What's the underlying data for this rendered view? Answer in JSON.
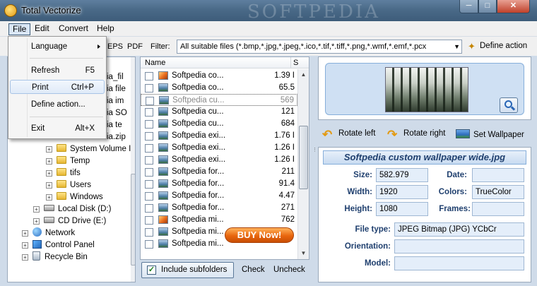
{
  "window": {
    "title": "Total Vectorize",
    "watermark": "SOFTPEDIA",
    "minimize": "─",
    "maximize": "□",
    "close": "✕"
  },
  "menubar": {
    "items": [
      "File",
      "Edit",
      "Convert",
      "Help"
    ]
  },
  "file_menu": {
    "items": [
      {
        "label": "Language",
        "shortcut": ""
      },
      {
        "label": "Refresh",
        "shortcut": "F5"
      },
      {
        "label": "Print",
        "shortcut": "Ctrl+P"
      },
      {
        "label": "Define action...",
        "shortcut": ""
      },
      {
        "label": "Exit",
        "shortcut": "Alt+X"
      }
    ]
  },
  "toolbar": {
    "formats": [
      "EPS",
      "PDF"
    ],
    "filter_label": "Filter:",
    "filter_value": "All suitable files (*.bmp,*.jpg,*.jpeg,*.ico,*.tif,*.tiff,*.png,*.wmf,*.emf,*.pcx",
    "define_action": "Define action"
  },
  "tree": {
    "partial_rows": [
      "ia_fil",
      "ia file",
      "ia im",
      "ia SO",
      "ia te",
      "ia.zip"
    ],
    "folders": [
      "System Volume I",
      "Temp",
      "tifs",
      "Users",
      "Windows"
    ],
    "drives": [
      "Local Disk (D:)",
      "CD Drive (E:)"
    ],
    "roots": [
      "Network",
      "Control Panel",
      "Recycle Bin"
    ]
  },
  "filelist": {
    "col_name": "Name",
    "col_size": "S",
    "rows": [
      {
        "name": "Softpedia co...",
        "size": "1.39 I",
        "icon": "orange"
      },
      {
        "name": "Softpedia co...",
        "size": "65.5",
        "icon": "blue"
      },
      {
        "name": "Softpedia cu...",
        "size": "569",
        "icon": "blue"
      },
      {
        "name": "Softpedia cu...",
        "size": "121",
        "icon": "blue"
      },
      {
        "name": "Softpedia cu...",
        "size": "684",
        "icon": "blue"
      },
      {
        "name": "Softpedia exi...",
        "size": "1.76 I",
        "icon": "blue"
      },
      {
        "name": "Softpedia exi...",
        "size": "1.26 I",
        "icon": "blue"
      },
      {
        "name": "Softpedia exi...",
        "size": "1.26 I",
        "icon": "blue"
      },
      {
        "name": "Softpedia for...",
        "size": "211",
        "icon": "blue"
      },
      {
        "name": "Softpedia for...",
        "size": "91.4",
        "icon": "blue"
      },
      {
        "name": "Softpedia for...",
        "size": "4.47",
        "icon": "blue"
      },
      {
        "name": "Softpedia for...",
        "size": "271",
        "icon": "blue"
      },
      {
        "name": "Softpedia mi...",
        "size": "762",
        "icon": "orange"
      },
      {
        "name": "Softpedia mi...",
        "size": "",
        "icon": "blue"
      },
      {
        "name": "Softpedia mi...",
        "size": "",
        "icon": "blue"
      }
    ]
  },
  "buy_now": "BUY Now!",
  "bottom": {
    "include_subfolders": "Include subfolders",
    "check": "Check",
    "uncheck": "Uncheck"
  },
  "actions": {
    "rotate_left": "Rotate left",
    "rotate_right": "Rotate right",
    "set_wallpaper": "Set Wallpaper"
  },
  "info": {
    "filename": "Softpedia custom wallpaper wide.jpg",
    "size_label": "Size:",
    "size": "582.979",
    "date_label": "Date:",
    "date": "",
    "width_label": "Width:",
    "width": "1920",
    "colors_label": "Colors:",
    "colors": "TrueColor",
    "height_label": "Height:",
    "height": "1080",
    "frames_label": "Frames:",
    "frames": "",
    "file_type_label": "File type:",
    "file_type": "JPEG Bitmap (JPG) YCbCr",
    "orientation_label": "Orientation:",
    "orientation": "",
    "model_label": "Model:",
    "model": ""
  }
}
